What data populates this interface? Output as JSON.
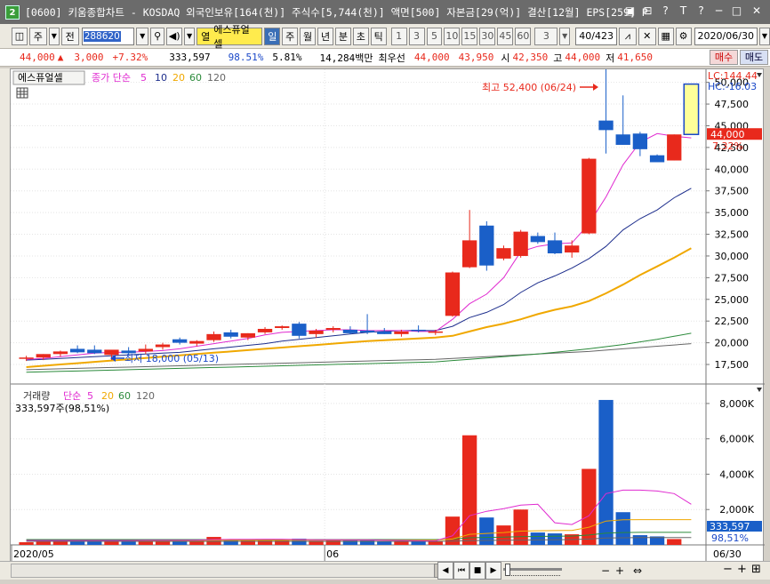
{
  "window": {
    "badge": "2",
    "title": "[0600] 키움종합차트 - KOSDAQ 외국인보유[164(천)] 주식수[5,744(천)] 액면[500] 자본금[29(억)] 결산[12월] EPS[259] PE",
    "buttons": [
      "▣",
      "⊟",
      "?",
      "T",
      "?",
      "─",
      "□",
      "✕"
    ]
  },
  "toolbar": {
    "view_label": "주",
    "prev_label": "전",
    "stock_code": "288620",
    "stock_name": "에스퓨얼셀",
    "name_tag": "열",
    "periods": [
      "일",
      "주",
      "월",
      "년",
      "분",
      "초",
      "틱"
    ],
    "selected_period": "일",
    "intervals": [
      "1",
      "3",
      "5",
      "10",
      "15",
      "30",
      "45",
      "60"
    ],
    "interval_value": "3",
    "count": "40/423",
    "date": "2020/06/30"
  },
  "quote": {
    "price": "44,000",
    "arrow": "▲",
    "change": "3,000",
    "change_pct": "+7.32%",
    "volume": "333,597",
    "volume_ratio": "98.51%",
    "turnover": "5.81%",
    "amount": "14,284백만",
    "bid_label": "최우선",
    "bid1": "44,000",
    "bid2": "43,950",
    "open_label": "시",
    "open": "42,350",
    "high_label": "고",
    "high": "44,000",
    "low_label": "저",
    "low": "41,650",
    "buy_label": "매수",
    "sell_label": "매도"
  },
  "chart_data": {
    "type": "candlestick",
    "price_legend": {
      "stock": "에스퓨얼셀",
      "ma_label": "종가 단순",
      "ma_periods": [
        "5",
        "10",
        "20",
        "60",
        "120"
      ],
      "ma_colors": [
        "#e02ad0",
        "#1c2d8c",
        "#f0a800",
        "#2a8a3a",
        "#666666"
      ]
    },
    "lc": "LC:144.44",
    "hc": "HC:-16.03",
    "current_price_label": "44,000",
    "current_pct_label": "7.32%",
    "max_annotation": "최고 52,400 (06/24)",
    "min_annotation": "최저 18,000 (05/13)",
    "y_ticks": [
      "50,000",
      "47,500",
      "45,000",
      "42,500",
      "40,000",
      "37,500",
      "35,000",
      "32,500",
      "30,000",
      "27,500",
      "25,000",
      "22,500",
      "20,000",
      "17,500"
    ],
    "y_tick_values": [
      50000,
      47500,
      45000,
      42500,
      40000,
      37500,
      35000,
      32500,
      30000,
      27500,
      25000,
      22500,
      20000,
      17500
    ],
    "ylim": [
      15250,
      51500
    ],
    "candles": [
      {
        "o": 18200,
        "h": 18500,
        "l": 17900,
        "c": 18300
      },
      {
        "o": 18300,
        "h": 18700,
        "l": 18000,
        "c": 18700
      },
      {
        "o": 18700,
        "h": 19100,
        "l": 18400,
        "c": 19000
      },
      {
        "o": 19300,
        "h": 19700,
        "l": 18800,
        "c": 18900
      },
      {
        "o": 19200,
        "h": 19700,
        "l": 18700,
        "c": 18800
      },
      {
        "o": 18600,
        "h": 19100,
        "l": 18000,
        "c": 19200
      },
      {
        "o": 19100,
        "h": 19500,
        "l": 18600,
        "c": 18800
      },
      {
        "o": 19000,
        "h": 19800,
        "l": 18700,
        "c": 19300
      },
      {
        "o": 19500,
        "h": 20000,
        "l": 19200,
        "c": 19800
      },
      {
        "o": 20400,
        "h": 20600,
        "l": 19800,
        "c": 20000
      },
      {
        "o": 19900,
        "h": 20300,
        "l": 19600,
        "c": 20200
      },
      {
        "o": 20300,
        "h": 21300,
        "l": 20100,
        "c": 21000
      },
      {
        "o": 21200,
        "h": 21500,
        "l": 20500,
        "c": 20700
      },
      {
        "o": 20600,
        "h": 21100,
        "l": 20300,
        "c": 21100
      },
      {
        "o": 21200,
        "h": 21800,
        "l": 21000,
        "c": 21600
      },
      {
        "o": 21700,
        "h": 22000,
        "l": 21500,
        "c": 21900
      },
      {
        "o": 22200,
        "h": 22400,
        "l": 20500,
        "c": 20800
      },
      {
        "o": 21000,
        "h": 21600,
        "l": 20600,
        "c": 21400
      },
      {
        "o": 21500,
        "h": 21900,
        "l": 21200,
        "c": 21700
      },
      {
        "o": 21500,
        "h": 21900,
        "l": 21000,
        "c": 21100
      },
      {
        "o": 21400,
        "h": 23300,
        "l": 21000,
        "c": 21200
      },
      {
        "o": 21300,
        "h": 21700,
        "l": 21000,
        "c": 21000
      },
      {
        "o": 21000,
        "h": 21500,
        "l": 20700,
        "c": 21300
      },
      {
        "o": 21500,
        "h": 22000,
        "l": 21200,
        "c": 21400
      },
      {
        "o": 21300,
        "h": 21500,
        "l": 20900,
        "c": 21300
      },
      {
        "o": 23100,
        "h": 28200,
        "l": 23000,
        "c": 28100
      },
      {
        "o": 28700,
        "h": 35300,
        "l": 28600,
        "c": 31800
      },
      {
        "o": 33500,
        "h": 34000,
        "l": 28300,
        "c": 28900
      },
      {
        "o": 29700,
        "h": 31200,
        "l": 29500,
        "c": 30900
      },
      {
        "o": 30000,
        "h": 33000,
        "l": 29800,
        "c": 32800
      },
      {
        "o": 32300,
        "h": 32700,
        "l": 31400,
        "c": 31600
      },
      {
        "o": 31800,
        "h": 32700,
        "l": 30200,
        "c": 30300
      },
      {
        "o": 30400,
        "h": 31800,
        "l": 29800,
        "c": 31200
      },
      {
        "o": 32600,
        "h": 41300,
        "l": 32500,
        "c": 41200
      },
      {
        "o": 45600,
        "h": 52400,
        "l": 41800,
        "c": 44500
      },
      {
        "o": 44000,
        "h": 48500,
        "l": 42800,
        "c": 42800
      },
      {
        "o": 44100,
        "h": 44300,
        "l": 41500,
        "c": 42300
      },
      {
        "o": 41600,
        "h": 41700,
        "l": 40800,
        "c": 40800
      },
      {
        "o": 41000,
        "h": 44000,
        "l": 41000,
        "c": 44000
      },
      {
        "o": 44000,
        "h": 49800,
        "l": 44000,
        "c": 44000
      }
    ],
    "ma5": [
      18100,
      18200,
      18400,
      18600,
      18800,
      18900,
      18900,
      19000,
      19100,
      19300,
      19600,
      19900,
      20200,
      20500,
      20900,
      21200,
      21300,
      21400,
      21500,
      21500,
      21400,
      21400,
      21400,
      21300,
      21300,
      22700,
      24500,
      25600,
      27500,
      30500,
      31100,
      31400,
      31500,
      33700,
      36800,
      40500,
      43100,
      44100,
      43800,
      43600
    ],
    "ma10": [
      18000,
      18100,
      18200,
      18300,
      18400,
      18500,
      18600,
      18700,
      18800,
      18900,
      19100,
      19300,
      19500,
      19700,
      19900,
      20200,
      20400,
      20600,
      20800,
      21000,
      21200,
      21300,
      21400,
      21400,
      21400,
      21900,
      22900,
      23500,
      24400,
      25800,
      26900,
      27700,
      28600,
      29700,
      31100,
      33000,
      34300,
      35300,
      36700,
      37800
    ],
    "ma20": [
      17200,
      17350,
      17500,
      17650,
      17800,
      17950,
      18100,
      18250,
      18400,
      18550,
      18700,
      18850,
      19000,
      19150,
      19300,
      19450,
      19600,
      19750,
      19900,
      20050,
      20200,
      20300,
      20400,
      20500,
      20600,
      20800,
      21300,
      21800,
      22200,
      22700,
      23300,
      23800,
      24200,
      24800,
      25700,
      26700,
      27800,
      28800,
      29800,
      30900
    ],
    "ma60": [
      16600,
      16650,
      16700,
      16750,
      16800,
      16850,
      16900,
      16950,
      17000,
      17050,
      17100,
      17150,
      17200,
      17250,
      17300,
      17350,
      17400,
      17450,
      17500,
      17550,
      17600,
      17650,
      17700,
      17750,
      17800,
      17950,
      18100,
      18250,
      18400,
      18550,
      18700,
      18900,
      19100,
      19300,
      19550,
      19800,
      20100,
      20400,
      20750,
      21100
    ],
    "ma120": [
      16900,
      16950,
      17000,
      17050,
      17100,
      17150,
      17200,
      17250,
      17300,
      17350,
      17400,
      17450,
      17500,
      17550,
      17600,
      17650,
      17700,
      17750,
      17800,
      17850,
      17900,
      17950,
      18000,
      18050,
      18100,
      18200,
      18300,
      18400,
      18500,
      18600,
      18700,
      18800,
      18900,
      19000,
      19150,
      19300,
      19450,
      19600,
      19750,
      19900
    ],
    "volume_legend": {
      "label": "거래량",
      "ma_label": "단순",
      "ma_periods": [
        "5",
        "20",
        "60",
        "120"
      ],
      "ma_colors": [
        "#e02ad0",
        "#f0a800",
        "#2a8a3a",
        "#666666"
      ],
      "value_text": "333,597주(98,51%)"
    },
    "vol_ticks": [
      "8,000K",
      "6,000K",
      "4,000K",
      "2,000K"
    ],
    "vol_tick_values": [
      8000,
      6000,
      4000,
      2000
    ],
    "vol_ylim": [
      0,
      8700
    ],
    "vol_current_label": "333,597",
    "vol_pct_label": "98,51%",
    "volumes": [
      150,
      200,
      260,
      240,
      230,
      250,
      220,
      280,
      300,
      260,
      270,
      450,
      280,
      250,
      300,
      280,
      350,
      240,
      260,
      250,
      300,
      220,
      200,
      230,
      210,
      1600,
      6200,
      1550,
      1100,
      2000,
      700,
      650,
      600,
      4300,
      8200,
      1850,
      550,
      480,
      330,
      0
    ],
    "vol_ma5": [
      250,
      250,
      250,
      250,
      250,
      250,
      250,
      260,
      260,
      260,
      270,
      300,
      310,
      310,
      320,
      320,
      300,
      290,
      290,
      280,
      280,
      260,
      250,
      240,
      230,
      520,
      1650,
      1900,
      2050,
      2250,
      2300,
      1250,
      1150,
      1650,
      2900,
      3100,
      3100,
      3050,
      2900,
      2300
    ],
    "vol_ma20": [
      250,
      250,
      250,
      250,
      250,
      250,
      250,
      250,
      250,
      250,
      250,
      260,
      260,
      260,
      260,
      260,
      270,
      270,
      270,
      270,
      270,
      270,
      270,
      270,
      270,
      330,
      600,
      650,
      700,
      780,
      800,
      810,
      820,
      1000,
      1350,
      1420,
      1430,
      1430,
      1430,
      1430
    ],
    "vol_ma60": [
      300,
      300,
      300,
      300,
      300,
      300,
      300,
      300,
      300,
      300,
      300,
      300,
      300,
      300,
      300,
      300,
      300,
      300,
      300,
      300,
      300,
      300,
      300,
      300,
      300,
      320,
      400,
      420,
      440,
      470,
      480,
      490,
      500,
      560,
      670,
      700,
      710,
      710,
      710,
      710
    ],
    "vol_ma120": [
      200,
      200,
      200,
      200,
      200,
      200,
      200,
      200,
      200,
      200,
      200,
      200,
      200,
      200,
      200,
      200,
      200,
      200,
      200,
      200,
      200,
      200,
      200,
      200,
      200,
      210,
      240,
      250,
      260,
      270,
      280,
      290,
      300,
      330,
      390,
      400,
      410,
      410,
      410,
      410
    ],
    "x_labels": [
      {
        "index": 0,
        "text": "2020/05"
      },
      {
        "index": 18,
        "text": "06"
      }
    ],
    "x_end_label": "06/30",
    "colors": {
      "up": "#e8291c",
      "down": "#1a5fc8",
      "max_arrow": "#e8291c",
      "min_arrow": "#1a48c8"
    }
  },
  "bottom": {
    "nav_buttons": [
      "◀",
      "⏮",
      "■",
      "▶",
      "⏭"
    ],
    "zoom_buttons": [
      "−",
      "+",
      "−",
      "+"
    ]
  }
}
